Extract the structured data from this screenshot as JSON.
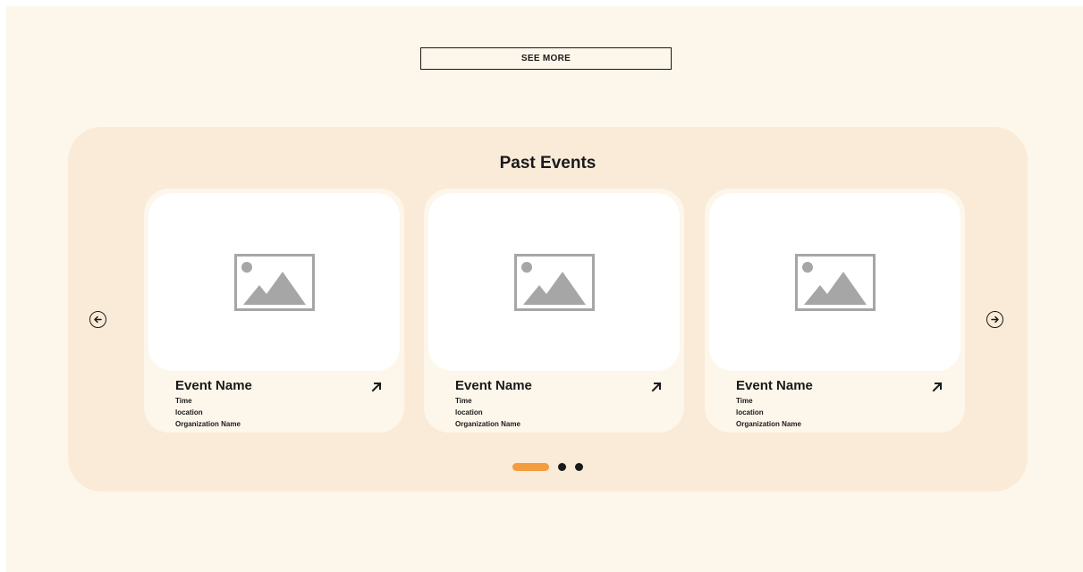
{
  "see_more": {
    "label": "SEE MORE"
  },
  "past_events": {
    "title": "Past Events",
    "cards": [
      {
        "name": "Event Name",
        "time": "Time",
        "location": "location",
        "organization": "Organization Name"
      },
      {
        "name": "Event Name",
        "time": "Time",
        "location": "location",
        "organization": "Organization Name"
      },
      {
        "name": "Event Name",
        "time": "Time",
        "location": "location",
        "organization": "Organization Name"
      }
    ],
    "pagination": {
      "total": 3,
      "active": 1
    }
  },
  "icons": {
    "prev": "arrow-left-circle-icon",
    "next": "arrow-right-circle-icon",
    "placeholder": "image-placeholder-icon",
    "card_link": "arrow-up-right-icon"
  },
  "colors": {
    "background": "#fdf6ea",
    "panel": "#faebd8",
    "accent": "#f49d3e",
    "text": "#1a1a1a"
  }
}
